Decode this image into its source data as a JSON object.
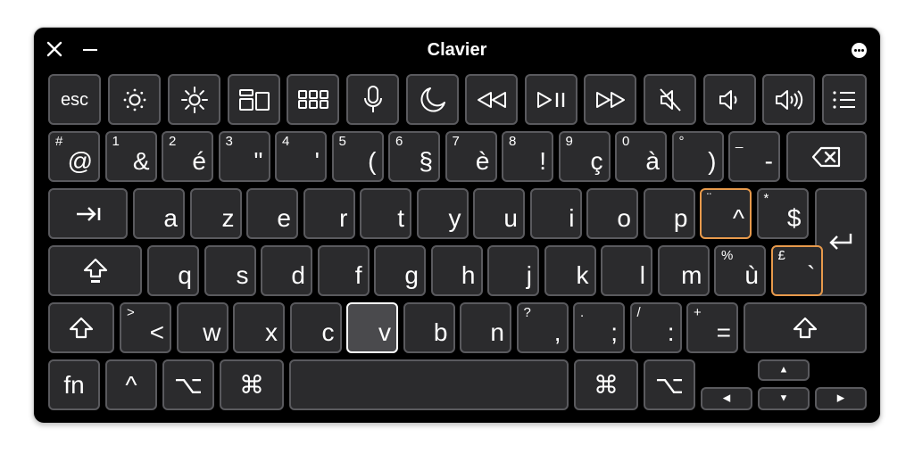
{
  "window": {
    "title": "Clavier"
  },
  "fkeys": [
    {
      "name": "esc-key",
      "label": "esc"
    },
    {
      "name": "brightness-down-key",
      "icon": "brightness-down-icon"
    },
    {
      "name": "brightness-up-key",
      "icon": "brightness-up-icon"
    },
    {
      "name": "mission-control-key",
      "icon": "mission-control-icon"
    },
    {
      "name": "launchpad-key",
      "icon": "launchpad-icon"
    },
    {
      "name": "dictation-key",
      "icon": "microphone-icon"
    },
    {
      "name": "focus-key",
      "icon": "moon-icon"
    },
    {
      "name": "rewind-key",
      "icon": "rewind-icon"
    },
    {
      "name": "play-pause-key",
      "icon": "play-pause-icon"
    },
    {
      "name": "fast-forward-key",
      "icon": "fast-forward-icon"
    },
    {
      "name": "mute-key",
      "icon": "mute-icon"
    },
    {
      "name": "volume-down-key",
      "icon": "volume-down-icon"
    },
    {
      "name": "volume-up-key",
      "icon": "volume-up-icon"
    },
    {
      "name": "list-key",
      "icon": "list-icon"
    }
  ],
  "number_row": [
    {
      "main": "@",
      "sec": "#"
    },
    {
      "main": "&",
      "sec": "1"
    },
    {
      "main": "é",
      "sec": "2"
    },
    {
      "main": "\"",
      "sec": "3"
    },
    {
      "main": "'",
      "sec": "4"
    },
    {
      "main": "(",
      "sec": "5"
    },
    {
      "main": "§",
      "sec": "6"
    },
    {
      "main": "è",
      "sec": "7"
    },
    {
      "main": "!",
      "sec": "8"
    },
    {
      "main": "ç",
      "sec": "9"
    },
    {
      "main": "à",
      "sec": "0"
    },
    {
      "main": ")",
      "sec": "°"
    },
    {
      "main": "-",
      "sec": "_"
    }
  ],
  "top_row": [
    {
      "main": "a"
    },
    {
      "main": "z"
    },
    {
      "main": "e"
    },
    {
      "main": "r"
    },
    {
      "main": "t"
    },
    {
      "main": "y"
    },
    {
      "main": "u"
    },
    {
      "main": "i"
    },
    {
      "main": "o"
    },
    {
      "main": "p"
    },
    {
      "main": "^",
      "sec": "¨",
      "highlight": true
    },
    {
      "main": "$",
      "sec": "*"
    }
  ],
  "home_row": [
    {
      "main": "q"
    },
    {
      "main": "s"
    },
    {
      "main": "d"
    },
    {
      "main": "f"
    },
    {
      "main": "g"
    },
    {
      "main": "h"
    },
    {
      "main": "j"
    },
    {
      "main": "k"
    },
    {
      "main": "l"
    },
    {
      "main": "m"
    },
    {
      "main": "ù",
      "sec": "%"
    },
    {
      "main": "`",
      "sec": "£",
      "highlight": true
    }
  ],
  "bottom_row": [
    {
      "main": "<",
      "sec": ">"
    },
    {
      "main": "w"
    },
    {
      "main": "x"
    },
    {
      "main": "c"
    },
    {
      "main": "v",
      "pressed": true
    },
    {
      "main": "b"
    },
    {
      "main": "n"
    },
    {
      "main": ",",
      "sec": "?"
    },
    {
      "main": ";",
      "sec": "."
    },
    {
      "main": ":",
      "sec": "/"
    },
    {
      "main": "=",
      "sec": "+"
    }
  ],
  "modifiers": {
    "fn": "fn",
    "control": "^",
    "option": "⌥",
    "command": "⌘",
    "tab": "⇥",
    "shift": "⇧",
    "delete": "⌫",
    "return": "↵"
  },
  "arrows": {
    "up": "▲",
    "left": "◀",
    "down": "▼",
    "right": "▶"
  }
}
